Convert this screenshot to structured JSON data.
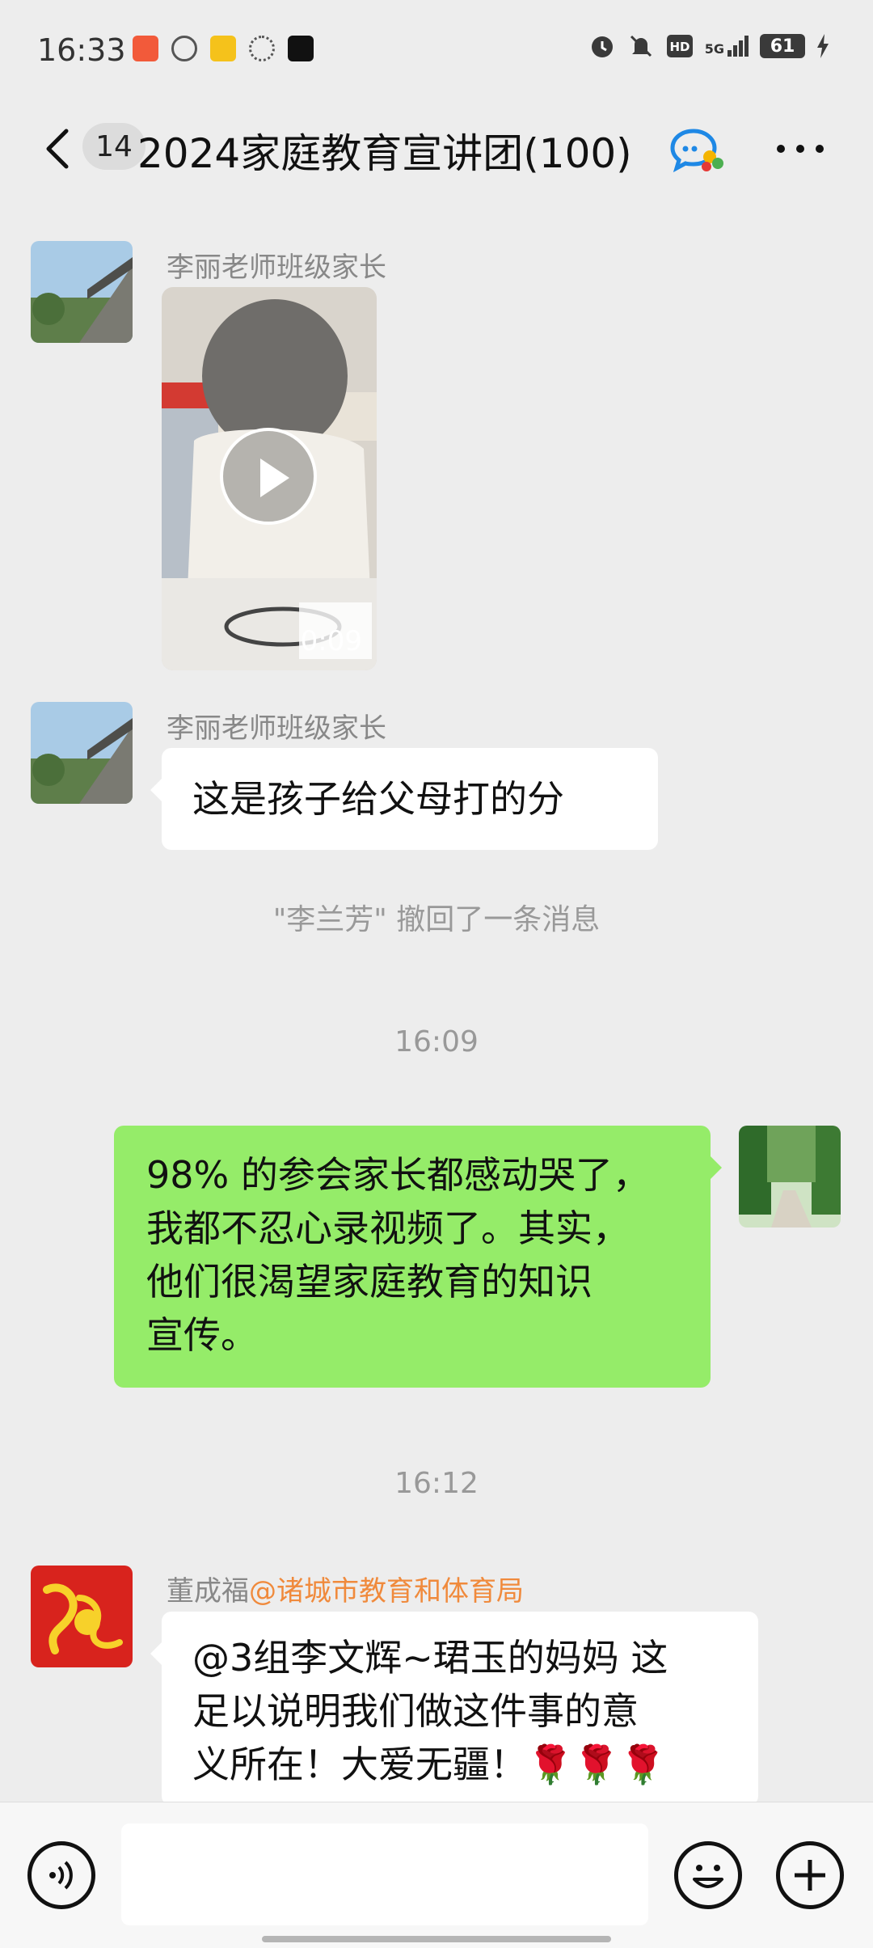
{
  "status_bar": {
    "time": "16:33",
    "network": "5G",
    "battery": "61",
    "app_icons": [
      {
        "name": "app-icon-red",
        "color": "#f25a3a"
      },
      {
        "name": "app-icon-search",
        "color": "#555555"
      },
      {
        "name": "app-icon-yellow",
        "color": "#f5c21b"
      },
      {
        "name": "app-icon-signal",
        "color": "#555555"
      },
      {
        "name": "app-icon-tiktok",
        "color": "#111111"
      }
    ]
  },
  "nav": {
    "unread_count": "14",
    "title": "2024家庭教育宣讲团(100)"
  },
  "messages": {
    "m1": {
      "sender": "李丽老师班级家长",
      "video_duration": "0:09"
    },
    "m2": {
      "sender": "李丽老师班级家长",
      "text": "这是孩子给父母打的分"
    },
    "recall": "\"李兰芳\" 撤回了一条消息",
    "ts1": "16:09",
    "m3": {
      "lines": [
        "98% 的参会家长都感动哭了，",
        "我都不忍心录视频了。其实，",
        "他们很渴望家庭教育的知识",
        "宣传。"
      ]
    },
    "ts2": "16:12",
    "m4": {
      "sender": "董成福",
      "sender_mention": "@诸城市教育和体育局",
      "lines": [
        "@3组李文辉~珺玉的妈妈 这",
        "足以说明我们做这件事的意",
        "义所在！大爱无疆！🌹🌹🌹"
      ]
    }
  },
  "colors": {
    "bubble_me": "#95ec69",
    "bubble_other": "#ffffff",
    "background": "#ededed",
    "mention": "#f08a3c"
  }
}
